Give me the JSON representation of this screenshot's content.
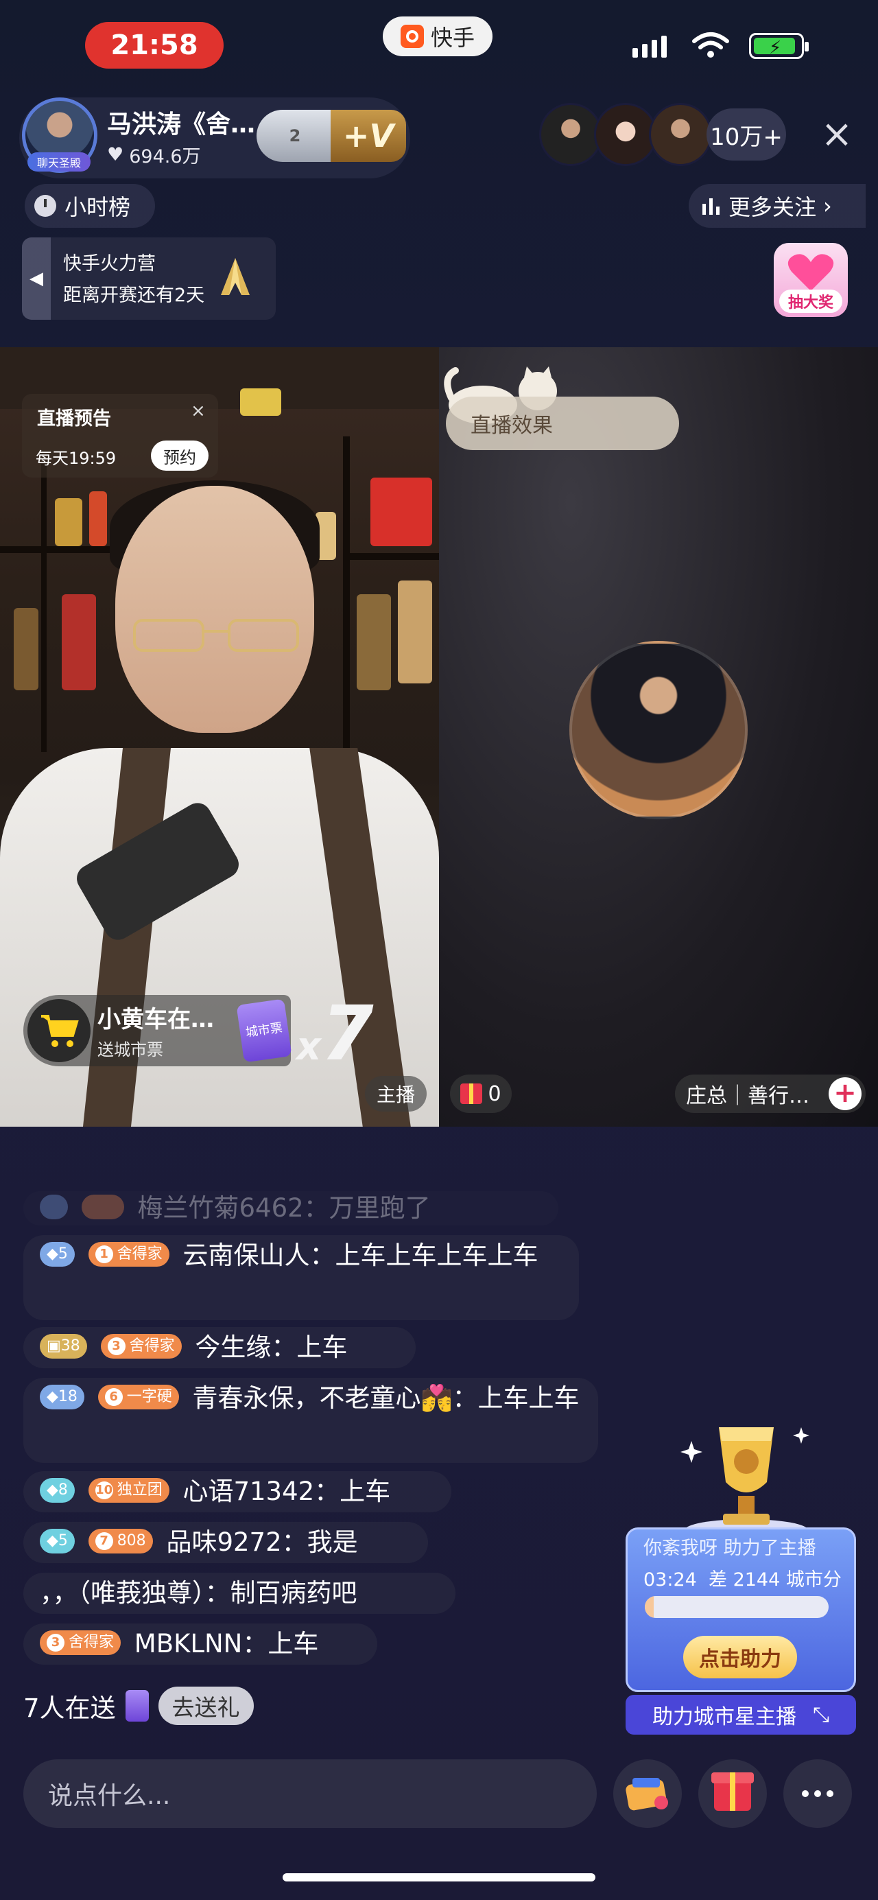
{
  "status_bar": {
    "time": "21:58",
    "app_name": "快手"
  },
  "anchor": {
    "name": "马洪涛《舍…",
    "likes": "694.6万",
    "avatar_badge": "聊天圣殿",
    "rank_level": "2",
    "vip_label": "+V"
  },
  "viewers": {
    "count": "10万+"
  },
  "hourly_rank": {
    "label": "小时榜"
  },
  "more_follow": {
    "label": "更多关注"
  },
  "fire_camp": {
    "title": "快手火力营",
    "subtitle": "距离开赛还有2天"
  },
  "lottery": {
    "label": "抽大奖"
  },
  "live_preview": {
    "title": "直播预告",
    "time": "每天19:59",
    "button": "预约"
  },
  "cart": {
    "title": "小黄车在…",
    "subtitle": "送城市票",
    "ticket_label": "城市票",
    "multiplier_x": "x",
    "multiplier_n": "7"
  },
  "host_label": "主播",
  "live_effect": {
    "label": "直播效果"
  },
  "guest": {
    "gift_count": "0",
    "name": "庄总｜善行…"
  },
  "comments": [
    {
      "faded": true,
      "text": "梅兰竹菊6462：万里跑了"
    },
    {
      "badges": [
        "5",
        "舍得家"
      ],
      "badge_nums": [
        "",
        "1"
      ],
      "text": "云南保山人：上车上车上车上车"
    },
    {
      "badges": [
        "38",
        "舍得家"
      ],
      "badge_nums": [
        "",
        "3"
      ],
      "text": "今生缘：上车"
    },
    {
      "badges": [
        "18",
        "一字硬"
      ],
      "badge_nums": [
        "",
        "6"
      ],
      "text": "青春永保，不老童心💏：上车上车"
    },
    {
      "badges": [
        "8",
        "独立团"
      ],
      "badge_nums": [
        "",
        "10"
      ],
      "text": "心语71342：上车"
    },
    {
      "badges": [
        "5",
        "808"
      ],
      "badge_nums": [
        "",
        "7"
      ],
      "text_line1": "品味9272：我是",
      "text_line2": "，，（唯莪独尊）：制百病药吧"
    },
    {
      "badges": [
        "舍得家"
      ],
      "badge_nums": [
        "3"
      ],
      "text": "MBKLNN：上车"
    }
  ],
  "send_gift": {
    "text": "7人在送",
    "button": "去送礼"
  },
  "help_card": {
    "line1": "你紊我呀  助力了主播",
    "countdown": "03:24",
    "gap": "差 2144 城市分",
    "progress": 0.05,
    "button": "点击助力",
    "footer": "助力城市星主播"
  },
  "input": {
    "placeholder": "说点什么..."
  },
  "colors": {
    "accent_red": "#e0332e",
    "help_blue": "#4a46d8",
    "gift_red": "#e8354a"
  },
  "icons": [
    "heart-icon",
    "clock-icon",
    "bar-chart-icon",
    "chevron-right-icon",
    "close-icon",
    "cart-icon",
    "gift-icon",
    "more-dots-icon",
    "minimize-icon"
  ]
}
